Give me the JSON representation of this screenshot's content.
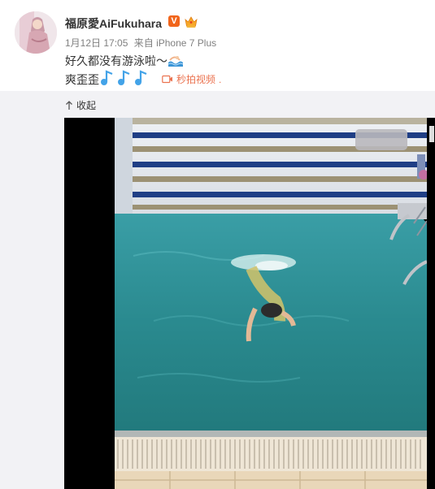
{
  "post": {
    "username": "福原愛AiFukuhara",
    "verified_badge": "V",
    "member_icon": "crown-member-icon",
    "date": "1月12日 17:05",
    "source": "来自 iPhone 7 Plus",
    "text_line1": "好久都没有游泳啦～",
    "text_line1_emoji": "swimmer-wave-icon",
    "text_line2": "爽歪歪",
    "text_line2_emoji": "music-note-icon",
    "video_link_label": "秒拍视频",
    "video_link_suffix": "."
  },
  "expanded": {
    "collapse_label": "收起"
  },
  "colors": {
    "accent_orange": "#eb7350",
    "verified_orange": "#f1651b",
    "pool_water": "#2f8c90",
    "panel_bg": "#f2f2f5"
  }
}
